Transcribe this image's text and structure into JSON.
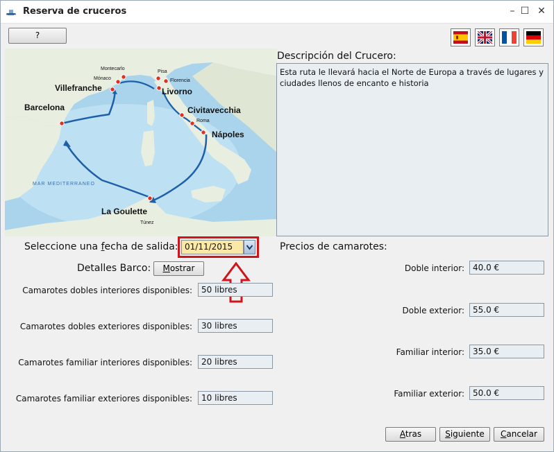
{
  "window": {
    "title": "Reserva de cruceros"
  },
  "help_button": {
    "label": "?"
  },
  "languages": [
    {
      "name": "spanish-flag-icon",
      "code": "ES"
    },
    {
      "name": "uk-flag-icon",
      "code": "EN"
    },
    {
      "name": "france-flag-icon",
      "code": "FR"
    },
    {
      "name": "germany-flag-icon",
      "code": "DE"
    }
  ],
  "map": {
    "sea_label": "MAR MEDITERRANEO",
    "cities": {
      "montecarlo": "Montecarlo",
      "monaco": "Mónaco",
      "villefranche": "Villefranche",
      "barcelona": "Barcelona",
      "pisa": "Pisa",
      "florencia": "Florencia",
      "livorno": "Livorno",
      "civitavecchia": "Civitavecchia",
      "roma": "Roma",
      "napoles": "Nápoles",
      "la_goulette": "La Goulette",
      "tunez": "Túnez"
    }
  },
  "description": {
    "label": "Descripción del Crucero:",
    "text": "Esta ruta le llevará hacia el Norte de Europa a través de lugares y ciudades llenos de encanto e historia"
  },
  "departure": {
    "label_before": "Seleccione una ",
    "label_underlined": "f",
    "label_after": "echa de salida:",
    "value": "01/11/2015"
  },
  "ship": {
    "label": "Detalles Barco:",
    "button_mnemonic": "M",
    "button_rest": "ostrar"
  },
  "availability": [
    {
      "label": "Camarotes dobles interiores disponibles:",
      "value": "50 libres"
    },
    {
      "label": "Camarotes dobles exteriores disponibles:",
      "value": "30 libres"
    },
    {
      "label": "Camarotes familiar interiores disponibles:",
      "value": "20 libres"
    },
    {
      "label": "Camarotes familiar exteriores disponibles:",
      "value": "10 libres"
    }
  ],
  "prices": {
    "heading": "Precios de camarotes:",
    "items": [
      {
        "label": "Doble interior:",
        "value": "40.0 €"
      },
      {
        "label": "Doble exterior:",
        "value": "55.0 €"
      },
      {
        "label": "Familiar interior:",
        "value": "35.0 €"
      },
      {
        "label": "Familiar exterior:",
        "value": "50.0 €"
      }
    ]
  },
  "footer": {
    "back": {
      "mnemonic": "A",
      "rest": "tras"
    },
    "next": {
      "mnemonic": "S",
      "rest": "iguiente"
    },
    "cancel": {
      "mnemonic": "C",
      "rest": "ancelar"
    }
  },
  "colors": {
    "highlight": "#d0141a",
    "date_field": "#f9e8a6",
    "field_bg": "#e9eef3"
  }
}
